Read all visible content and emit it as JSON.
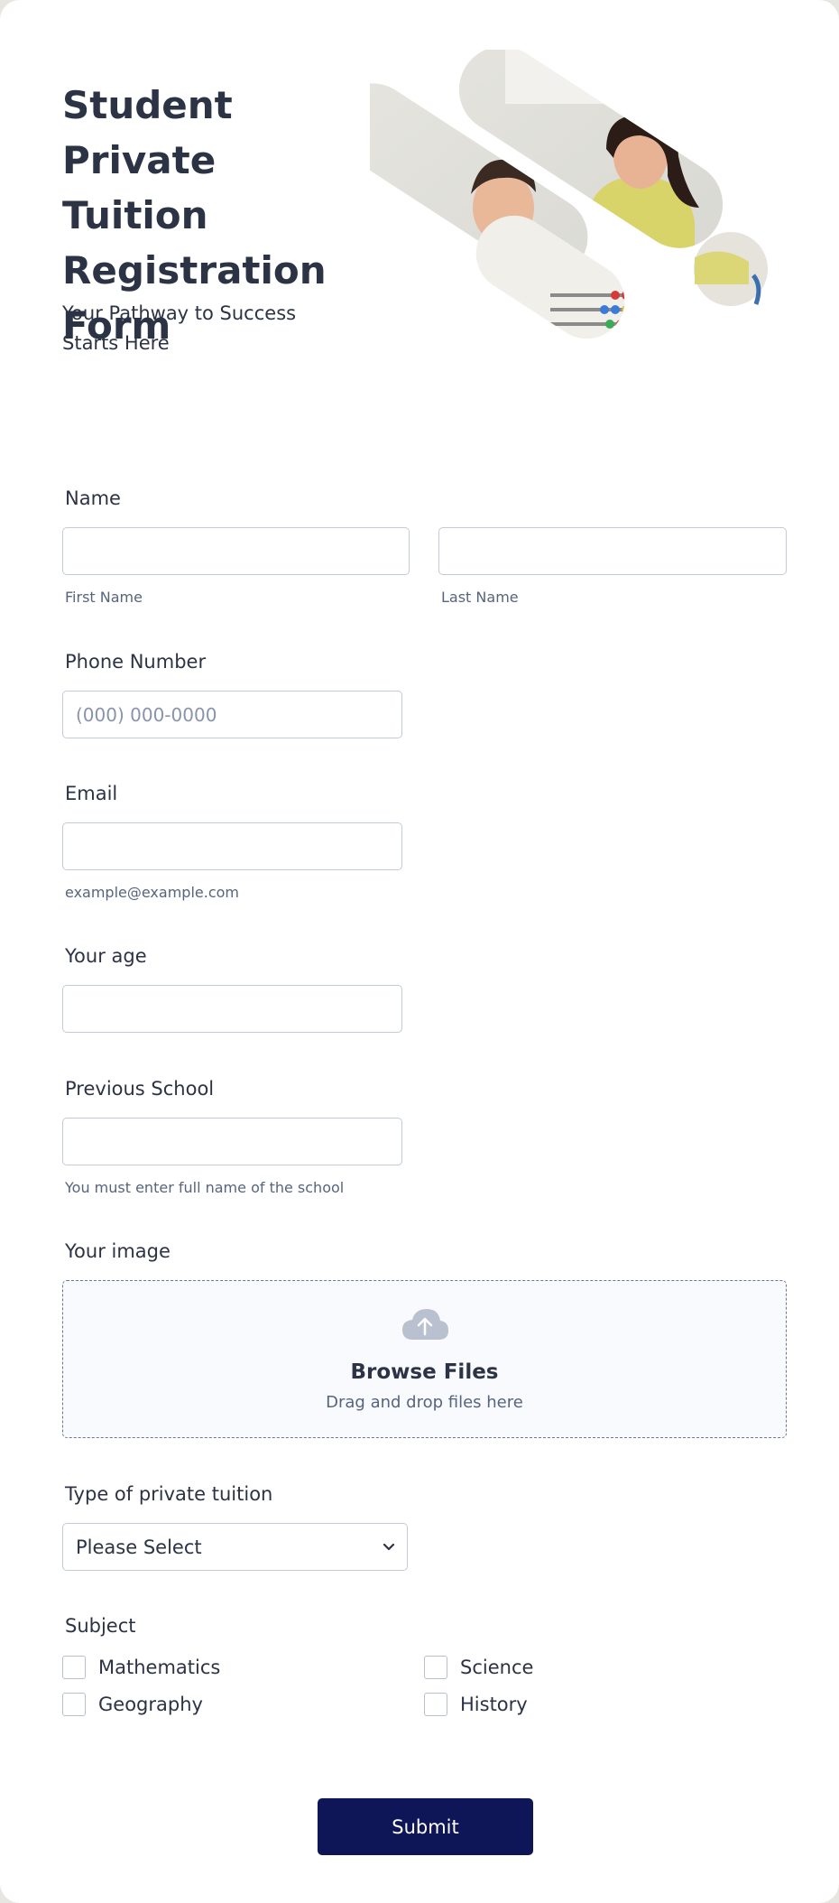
{
  "header": {
    "title": "Student Private Tuition Registration Form",
    "subtitle": "Your Pathway to Success Starts Here"
  },
  "colors": {
    "primary_button": "#0f1657",
    "text": "#2c3345",
    "muted_text": "#57647e",
    "border": "#c3cad8"
  },
  "fields": {
    "name": {
      "label": "Name",
      "first_sublabel": "First Name",
      "last_sublabel": "Last Name",
      "first_value": "",
      "last_value": ""
    },
    "phone": {
      "label": "Phone Number",
      "placeholder": "(000) 000-0000",
      "value": ""
    },
    "email": {
      "label": "Email",
      "sublabel": "example@example.com",
      "value": ""
    },
    "age": {
      "label": "Your age",
      "value": ""
    },
    "school": {
      "label": "Previous School",
      "sublabel": "You must enter full name of the school",
      "value": ""
    },
    "image": {
      "label": "Your image",
      "icon": "cloud-upload-icon",
      "browse": "Browse Files",
      "drag": "Drag and drop files here"
    },
    "tuition_type": {
      "label": "Type of private tuition",
      "selected": "Please Select"
    },
    "subject": {
      "label": "Subject",
      "options": [
        "Mathematics",
        "Science",
        "Geography",
        "History"
      ]
    }
  },
  "submit_label": "Submit"
}
